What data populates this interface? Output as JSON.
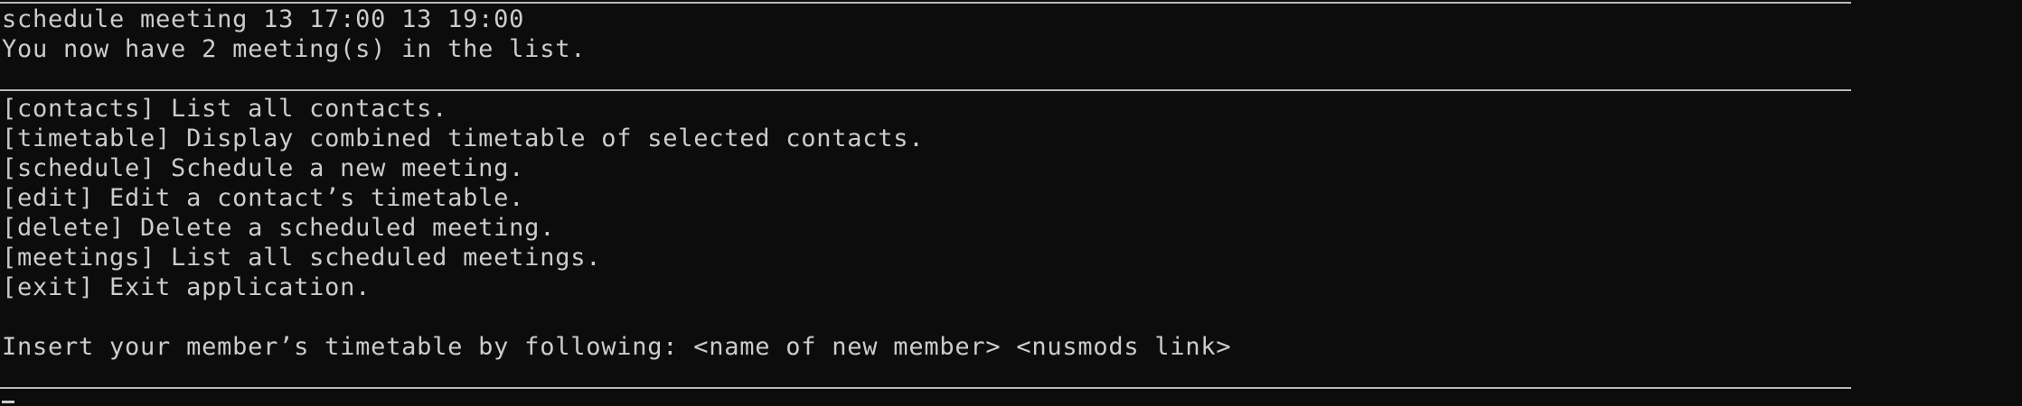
{
  "terminal": {
    "output": {
      "command_echo": "schedule meeting 13 17:00 13 19:00",
      "result_message": "You now have 2 meeting(s) in the list."
    },
    "help_menu": [
      "[contacts] List all contacts.",
      "[timetable] Display combined timetable of selected contacts.",
      "[schedule] Schedule a new meeting.",
      "[edit] Edit a contact’s timetable.",
      "[delete] Delete a scheduled meeting.",
      "[meetings] List all scheduled meetings.",
      "[exit] Exit application."
    ],
    "prompt": "Insert your member’s timetable by following: <name of new member> <nusmods link>"
  }
}
